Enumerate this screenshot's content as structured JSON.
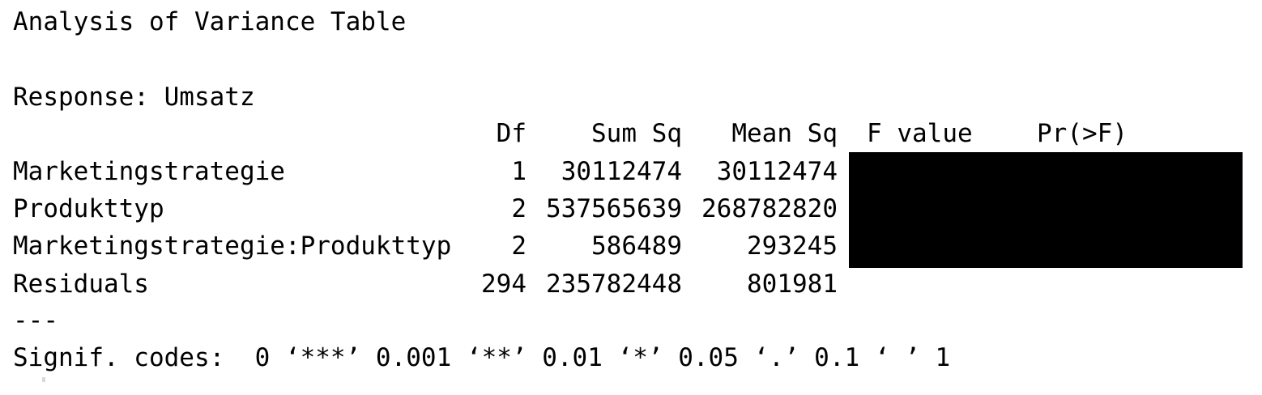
{
  "title": "Analysis of Variance Table",
  "response_line": "Response: Umsatz",
  "headers": {
    "df": "Df",
    "sum_sq": "Sum Sq",
    "mean_sq": "Mean Sq",
    "f_value": "F value",
    "p_value": "Pr(>F)"
  },
  "rows": [
    {
      "name": "Marketingstrategie",
      "df": "1",
      "sum_sq": "30112474",
      "mean_sq": "30112474"
    },
    {
      "name": "Produkttyp",
      "df": "2",
      "sum_sq": "537565639",
      "mean_sq": "268782820"
    },
    {
      "name": "Marketingstrategie:Produkttyp",
      "df": "2",
      "sum_sq": "586489",
      "mean_sq": "293245"
    },
    {
      "name": "Residuals",
      "df": "294",
      "sum_sq": "235782448",
      "mean_sq": "801981"
    }
  ],
  "separator": "---",
  "signif_codes": "Signif. codes:  0 ‘***’ 0.001 ‘**’ 0.01 ‘*’ 0.05 ‘.’ 0.1 ‘ ’ 1",
  "redaction_color": "#000000"
}
